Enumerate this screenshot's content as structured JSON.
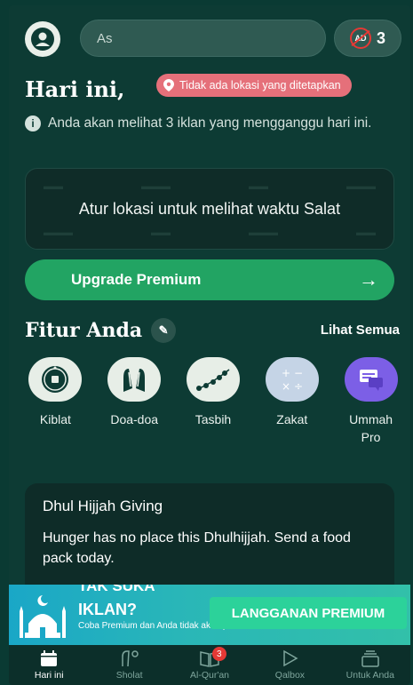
{
  "header": {
    "search_value": "As",
    "ad_count": "3",
    "ad_icon_text": "AD"
  },
  "today": {
    "title": "Hari ini,",
    "location_pill": "Tidak ada lokasi yang ditetapkan",
    "info_text": "Anda akan melihat 3 iklan yang mengganggu hari ini."
  },
  "prayer_card": {
    "message": "Atur lokasi untuk melihat waktu Salat"
  },
  "upgrade": {
    "label": "Upgrade Premium",
    "arrow": "→"
  },
  "features": {
    "title": "Fitur Anda",
    "see_all": "Lihat Semua",
    "items": [
      {
        "label": "Kiblat",
        "icon": "compass-icon"
      },
      {
        "label": "Doa-doa",
        "icon": "praying-hands-icon"
      },
      {
        "label": "Tasbih",
        "icon": "prayer-beads-icon"
      },
      {
        "label": "Zakat",
        "icon": "calculator-icon"
      },
      {
        "label": "Ummah Pro",
        "icon": "chat-icon"
      }
    ]
  },
  "giving": {
    "title": "Dhul Hijjah Giving",
    "description": "Hunger has no place this Dhulhijjah. Send a food pack today."
  },
  "ad_banner": {
    "top_text": "TAK SUKA",
    "headline": "IKLAN?",
    "sub_text": "Coba Premium dan Anda tidak akan pernah",
    "cta": "LANGGANAN PREMIUM"
  },
  "bottom_nav": {
    "items": [
      {
        "label": "Hari ini",
        "icon": "calendar-icon",
        "active": true
      },
      {
        "label": "Sholat",
        "icon": "prayer-icon",
        "active": false
      },
      {
        "label": "Al-Qur'an",
        "icon": "book-icon",
        "active": false,
        "badge": "3"
      },
      {
        "label": "Qalbox",
        "icon": "play-icon",
        "active": false
      },
      {
        "label": "Untuk Anda",
        "icon": "stack-icon",
        "active": false
      }
    ]
  },
  "colors": {
    "background": "#0d3b34",
    "accent_green": "#22a463",
    "location_pill": "#e5707a",
    "alert_red": "#e53935"
  }
}
